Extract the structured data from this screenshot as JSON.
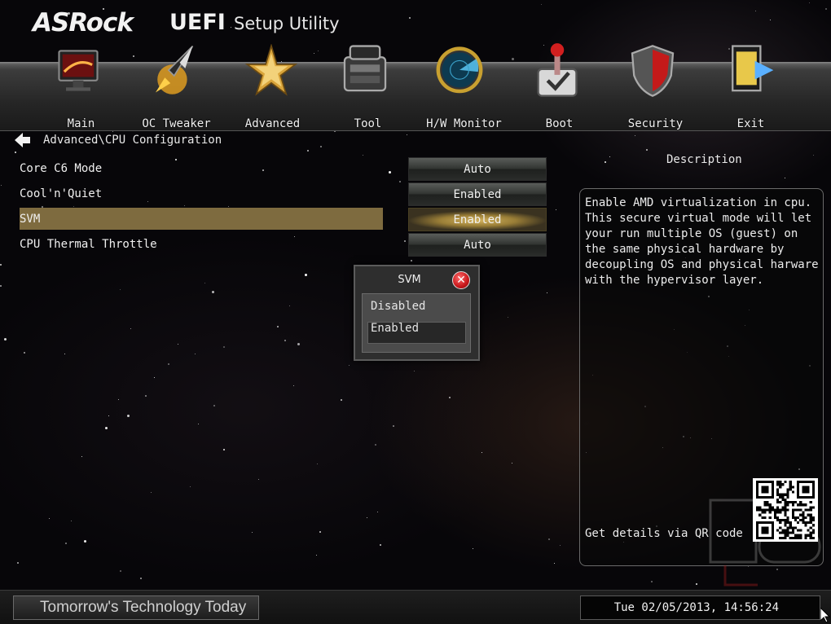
{
  "header": {
    "brand": "ASRock",
    "title_bold": "UEFI",
    "title_rest": "Setup Utility"
  },
  "tabs": [
    {
      "label": "Main",
      "icon": "monitor-icon"
    },
    {
      "label": "OC Tweaker",
      "icon": "rocket-icon"
    },
    {
      "label": "Advanced",
      "icon": "star-icon"
    },
    {
      "label": "Tool",
      "icon": "toolbox-icon"
    },
    {
      "label": "H/W Monitor",
      "icon": "radar-icon"
    },
    {
      "label": "Boot",
      "icon": "joystick-icon"
    },
    {
      "label": "Security",
      "icon": "shield-icon"
    },
    {
      "label": "Exit",
      "icon": "exit-door-icon"
    }
  ],
  "breadcrumb": "Advanced\\CPU Configuration",
  "settings": [
    {
      "label": "Core C6 Mode",
      "value": "Auto"
    },
    {
      "label": "Cool'n'Quiet",
      "value": "Enabled"
    },
    {
      "label": "SVM",
      "value": "Enabled",
      "selected": true
    },
    {
      "label": "CPU Thermal Throttle",
      "value": "Auto"
    }
  ],
  "popup": {
    "title": "SVM",
    "close_symbol": "✕",
    "options": [
      "Disabled",
      "Enabled"
    ],
    "selected": "Enabled"
  },
  "description": {
    "heading": "Description",
    "text": "Enable AMD virtualization in cpu. This secure virtual mode will let your run multiple OS (guest) on the same physical hardware by decoupling OS and physical harware with the hypervisor layer.",
    "qr_prompt": "Get details via QR code"
  },
  "footer": {
    "slogan": "Tomorrow's Technology Today",
    "datetime": "Tue 02/05/2013, 14:56:24"
  },
  "colors": {
    "highlight": "#7e6b3f",
    "selected_value": "#c8a54e",
    "close_button": "#c8171b"
  }
}
